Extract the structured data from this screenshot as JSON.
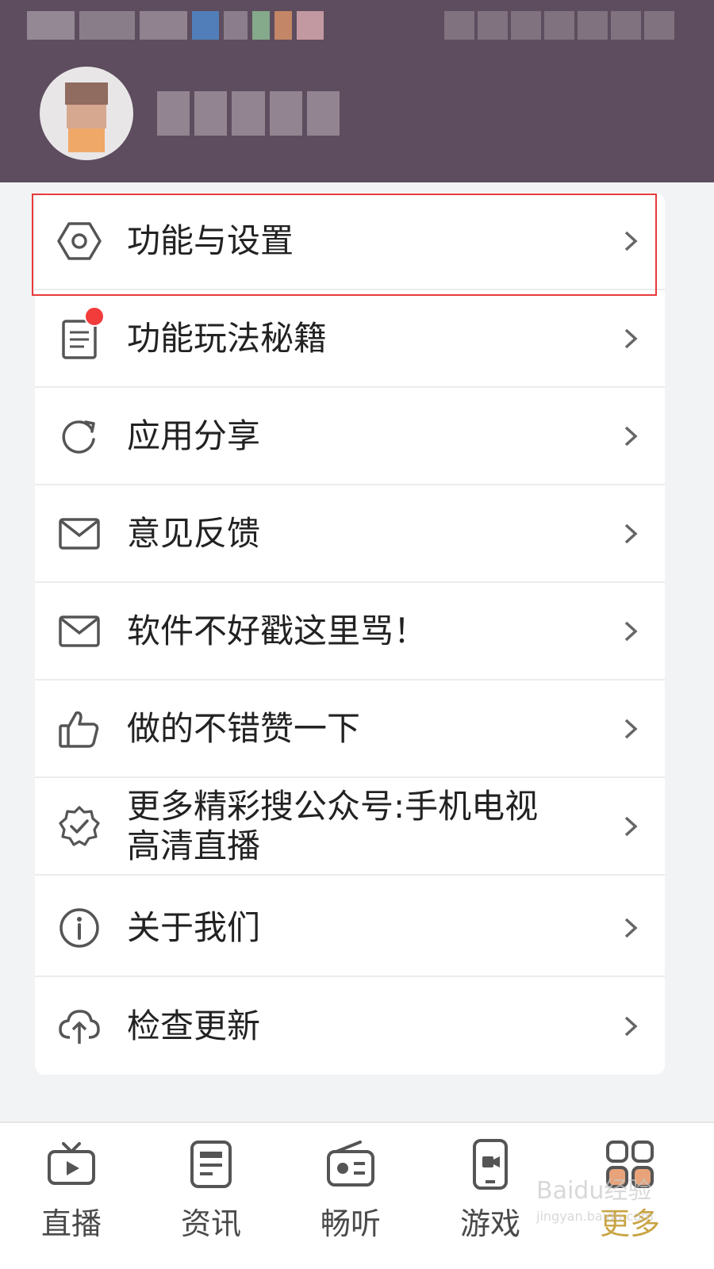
{
  "menu": {
    "items": [
      {
        "label": "功能与设置",
        "icon": "hexagon-settings-icon"
      },
      {
        "label": "功能玩法秘籍",
        "icon": "document-icon",
        "badge": true
      },
      {
        "label": "应用分享",
        "icon": "share-refresh-icon"
      },
      {
        "label": "意见反馈",
        "icon": "mail-icon"
      },
      {
        "label": "软件不好戳这里骂！",
        "icon": "mail-icon"
      },
      {
        "label": "做的不错赞一下",
        "icon": "thumbs-up-icon"
      },
      {
        "label": "更多精彩搜公众号:手机电视高清直播",
        "icon": "verified-badge-icon"
      },
      {
        "label": "关于我们",
        "icon": "info-icon"
      },
      {
        "label": "检查更新",
        "icon": "cloud-upload-icon"
      }
    ]
  },
  "nav": {
    "items": [
      {
        "label": "直播",
        "icon": "tv-icon"
      },
      {
        "label": "资讯",
        "icon": "news-icon"
      },
      {
        "label": "畅听",
        "icon": "radio-icon"
      },
      {
        "label": "游戏",
        "icon": "phone-game-icon"
      },
      {
        "label": "更多",
        "icon": "grid-more-icon",
        "active": true
      }
    ]
  },
  "watermark": {
    "text": "Baidu经验",
    "sub": "jingyan.baidu.com"
  },
  "colors": {
    "header_bg": "#5d4d5e",
    "highlight_border": "#e8393a",
    "badge": "#f23b3b",
    "active_nav": "#c9a443"
  }
}
